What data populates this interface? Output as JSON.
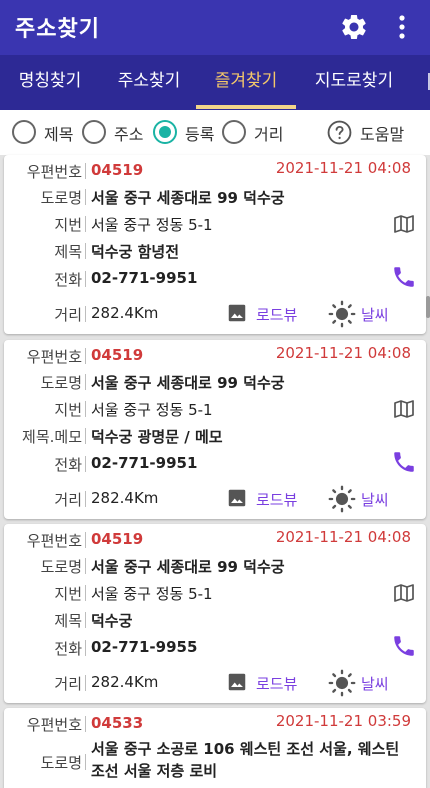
{
  "app": {
    "title": "주소찾기"
  },
  "tabs": [
    {
      "label": "명칭찾기"
    },
    {
      "label": "주소찾기"
    },
    {
      "label": "즐겨찾기"
    },
    {
      "label": "지도로찾기"
    }
  ],
  "active_tab": "즐겨찾기",
  "filters": [
    {
      "label": "제목",
      "checked": false
    },
    {
      "label": "주소",
      "checked": false
    },
    {
      "label": "등록",
      "checked": true
    },
    {
      "label": "거리",
      "checked": false
    }
  ],
  "help_label": "도움말",
  "field_labels": {
    "zip": "우편번호",
    "road": "도로명",
    "jibun": "지번",
    "title": "제목",
    "title_memo": "제목.메모",
    "phone": "전화",
    "distance": "거리"
  },
  "actions": {
    "roadview": "로드뷰",
    "weather": "날씨"
  },
  "colors": {
    "appbar": "#3a35b0",
    "tabbar": "#2d2995",
    "active_tab": "#f4c86a",
    "radio_checked": "#19b3a4",
    "zip": "#d03a3a",
    "action": "#7a3fe0"
  },
  "cards": [
    {
      "zip": "04519",
      "date": "2021-11-21 04:08",
      "road": "서울 중구 세종대로 99 덕수궁",
      "jibun": "서울 중구 정동 5-1",
      "title": "덕수궁 함녕전",
      "phone": "02-771-9951",
      "distance": "282.4Km"
    },
    {
      "zip": "04519",
      "date": "2021-11-21 04:08",
      "road": "서울 중구 세종대로 99 덕수궁",
      "jibun": "서울 중구 정동 5-1",
      "title": "덕수궁 광명문 / 메모",
      "phone": "02-771-9951",
      "distance": "282.4Km"
    },
    {
      "zip": "04519",
      "date": "2021-11-21 04:08",
      "road": "서울 중구 세종대로 99 덕수궁",
      "jibun": "서울 중구 정동 5-1",
      "title": "덕수궁",
      "phone": "02-771-9955",
      "distance": "282.4Km"
    },
    {
      "zip": "04533",
      "date": "2021-11-21 03:59",
      "road": "서울 중구 소공로 106 웨스틴 조선 서울, 웨스틴 조선 서울 저층 로비"
    }
  ]
}
